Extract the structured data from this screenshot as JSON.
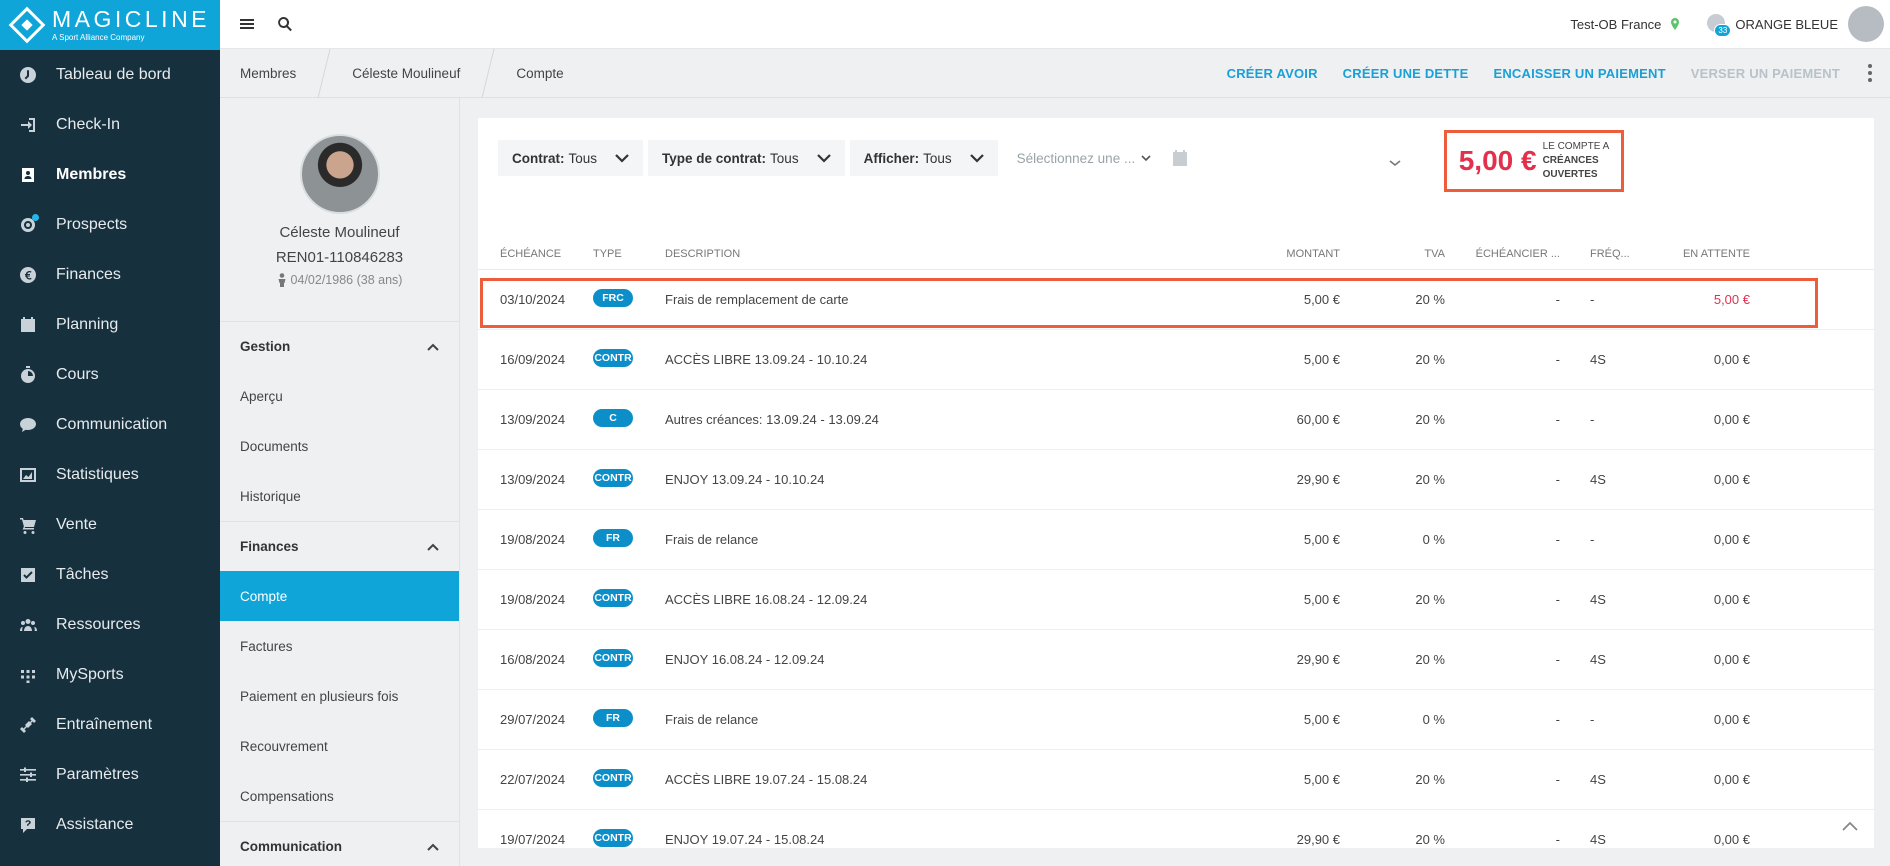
{
  "app": {
    "logo_name": "MAGICLINE",
    "logo_tag": "A Sport Alliance Company"
  },
  "sidebar": {
    "items": [
      {
        "label": "Tableau de bord",
        "icon": "dashboard-icon"
      },
      {
        "label": "Check-In",
        "icon": "checkin-icon"
      },
      {
        "label": "Membres",
        "icon": "members-icon",
        "active": true
      },
      {
        "label": "Prospects",
        "icon": "prospects-icon"
      },
      {
        "label": "Finances",
        "icon": "euro-icon"
      },
      {
        "label": "Planning",
        "icon": "calendar-icon"
      },
      {
        "label": "Cours",
        "icon": "stopwatch-icon"
      },
      {
        "label": "Communication",
        "icon": "chat-icon"
      },
      {
        "label": "Statistiques",
        "icon": "chart-icon"
      },
      {
        "label": "Vente",
        "icon": "cart-icon"
      },
      {
        "label": "Tâches",
        "icon": "task-icon"
      },
      {
        "label": "Ressources",
        "icon": "people-icon"
      },
      {
        "label": "MySports",
        "icon": "mysports-icon"
      },
      {
        "label": "Entraînement",
        "icon": "dumbbell-icon"
      },
      {
        "label": "Paramètres",
        "icon": "sliders-icon"
      },
      {
        "label": "Assistance",
        "icon": "help-icon"
      }
    ]
  },
  "topbar": {
    "studio": "Test-OB France",
    "notification_count": "33",
    "org": "ORANGE BLEUE"
  },
  "breadcrumb": [
    "Membres",
    "Céleste Moulineuf",
    "Compte"
  ],
  "actions": [
    {
      "label": "CRÉER AVOIR",
      "enabled": true
    },
    {
      "label": "CRÉER UNE DETTE",
      "enabled": true
    },
    {
      "label": "ENCAISSER UN PAIEMENT",
      "enabled": true
    },
    {
      "label": "VERSER UN PAIEMENT",
      "enabled": false
    }
  ],
  "member": {
    "name": "Céleste Moulineuf",
    "id": "REN01-110846283",
    "dob": "04/02/1986 (38 ans)"
  },
  "member_menu": {
    "gestion_title": "Gestion",
    "gestion": [
      "Aperçu",
      "Documents",
      "Historique"
    ],
    "finances_title": "Finances",
    "finances": [
      "Compte",
      "Factures",
      "Paiement en plusieurs fois",
      "Recouvrement",
      "Compensations"
    ],
    "communication_title": "Communication"
  },
  "filters": {
    "contract_label": "Contrat:",
    "contract_value": "Tous",
    "contract_type_label": "Type de contrat:",
    "contract_type_value": "Tous",
    "show_label": "Afficher:",
    "show_value": "Tous",
    "date_placeholder": "Sélectionnez une ..."
  },
  "balance": {
    "amount": "5,00 €",
    "label_1": "LE COMPTE A",
    "label_2": "CRÉANCES",
    "label_3": "OUVERTES"
  },
  "table": {
    "headers": [
      "ÉCHÉANCE",
      "TYPE",
      "DESCRIPTION",
      "MONTANT",
      "TVA",
      "ÉCHÉANCIER ...",
      "FRÉQ...",
      "EN ATTENTE"
    ],
    "rows": [
      {
        "due": "03/10/2024",
        "type": "FRC",
        "desc": "Frais de remplacement de carte",
        "amount": "5,00 €",
        "tva": "20 %",
        "sched": "-",
        "freq": "-",
        "pending": "5,00 €",
        "pending_red": true
      },
      {
        "due": "16/09/2024",
        "type": "CONTR",
        "desc": "ACCÈS LIBRE 13.09.24 - 10.10.24",
        "amount": "5,00 €",
        "tva": "20 %",
        "sched": "-",
        "freq": "4S",
        "pending": "0,00 €"
      },
      {
        "due": "13/09/2024",
        "type": "C",
        "desc": "Autres créances: 13.09.24 - 13.09.24",
        "amount": "60,00 €",
        "tva": "20 %",
        "sched": "-",
        "freq": "-",
        "pending": "0,00 €"
      },
      {
        "due": "13/09/2024",
        "type": "CONTR",
        "desc": "ENJOY 13.09.24 - 10.10.24",
        "amount": "29,90 €",
        "tva": "20 %",
        "sched": "-",
        "freq": "4S",
        "pending": "0,00 €"
      },
      {
        "due": "19/08/2024",
        "type": "FR",
        "desc": "Frais de relance",
        "amount": "5,00 €",
        "tva": "0 %",
        "sched": "-",
        "freq": "-",
        "pending": "0,00 €"
      },
      {
        "due": "19/08/2024",
        "type": "CONTR",
        "desc": "ACCÈS LIBRE 16.08.24 - 12.09.24",
        "amount": "5,00 €",
        "tva": "20 %",
        "sched": "-",
        "freq": "4S",
        "pending": "0,00 €"
      },
      {
        "due": "16/08/2024",
        "type": "CONTR",
        "desc": "ENJOY 16.08.24 - 12.09.24",
        "amount": "29,90 €",
        "tva": "20 %",
        "sched": "-",
        "freq": "4S",
        "pending": "0,00 €"
      },
      {
        "due": "29/07/2024",
        "type": "FR",
        "desc": "Frais de relance",
        "amount": "5,00 €",
        "tva": "0 %",
        "sched": "-",
        "freq": "-",
        "pending": "0,00 €"
      },
      {
        "due": "22/07/2024",
        "type": "CONTR",
        "desc": "ACCÈS LIBRE 19.07.24 - 15.08.24",
        "amount": "5,00 €",
        "tva": "20 %",
        "sched": "-",
        "freq": "4S",
        "pending": "0,00 €"
      },
      {
        "due": "19/07/2024",
        "type": "CONTR",
        "desc": "ENJOY 19.07.24 - 15.08.24",
        "amount": "29,90 €",
        "tva": "20 %",
        "sched": "-",
        "freq": "4S",
        "pending": "0,00 €"
      }
    ]
  },
  "colors": {
    "brand_blue": "#0fa5d9",
    "sidebar_bg": "#17303d",
    "alert_red": "#e2304d",
    "highlight_orange": "#ed5d3c",
    "pill_blue": "#0c8fc9"
  }
}
